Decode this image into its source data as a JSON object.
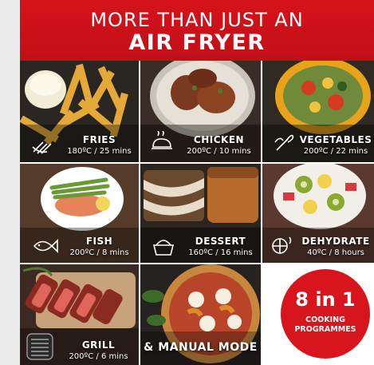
{
  "banner": {
    "line1": "MORE THAN JUST AN",
    "line2": "AIR FRYER"
  },
  "tiles": [
    {
      "name": "FRIES",
      "spec": "180ºC / 25 mins"
    },
    {
      "name": "CHICKEN",
      "spec": "200ºC / 10 mins"
    },
    {
      "name": "VEGETABLES",
      "spec": "200ºC / 22 mins"
    },
    {
      "name": "FISH",
      "spec": "200ºC / 8 mins"
    },
    {
      "name": "DESSERT",
      "spec": "160ºC / 16 mins"
    },
    {
      "name": "DEHYDRATE",
      "spec": "40ºC / 8 hours"
    },
    {
      "name": "GRILL",
      "spec": "200ºC / 6 mins"
    }
  ],
  "manual_mode": "& MANUAL MODE",
  "cta": {
    "big": "8 in 1",
    "line1": "COOKING",
    "line2": "PROGRAMMES"
  },
  "colors": {
    "brand_red": "#d7121b",
    "badge_red": "#d8141c"
  },
  "icons": [
    "fries-icon",
    "chicken-icon",
    "vegetables-icon",
    "fish-icon",
    "dessert-icon",
    "dehydrate-icon",
    "grill-icon"
  ]
}
